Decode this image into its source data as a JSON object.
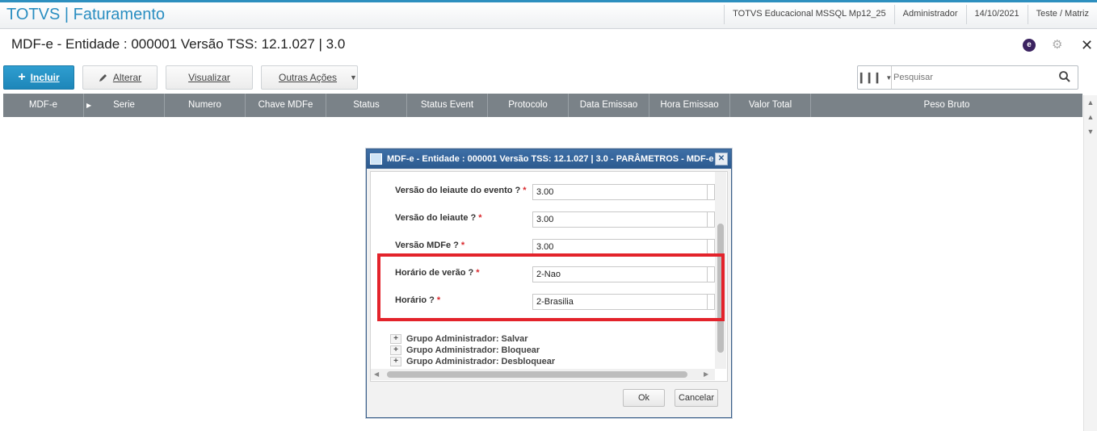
{
  "app": {
    "title": "TOTVS | Faturamento"
  },
  "top_info": [
    "TOTVS Educacional MSSQL Mp12_25",
    "Administrador",
    "14/10/2021",
    "Teste / Matriz"
  ],
  "page": {
    "title": "MDF-e - Entidade : 000001 Versão TSS: 12.1.027 | 3.0",
    "e_badge": "e",
    "gear_glyph": "⚙",
    "close_glyph": "✕"
  },
  "toolbar": {
    "incluir": "Incluir",
    "alterar": "Alterar",
    "visualizar": "Visualizar",
    "outras_acoes": "Outras Ações",
    "search_placeholder": "Pesquisar"
  },
  "grid": {
    "columns": [
      "MDF-e",
      "Serie",
      "Numero",
      "Chave MDFe",
      "Status",
      "Status Event",
      "Protocolo",
      "Data Emissao",
      "Hora Emissao",
      "Valor Total",
      "Peso Bruto"
    ]
  },
  "dialog": {
    "title": "MDF-e - Entidade : 000001 Versão TSS: 12.1.027 | 3.0 - PARÂMETROS - MDF-e",
    "params": [
      {
        "label": "Versão do leiaute do evento ?",
        "value": "3.00"
      },
      {
        "label": "Versão do leiaute ?",
        "value": "3.00"
      },
      {
        "label": "Versão MDFe ?",
        "value": "3.00"
      },
      {
        "label": "Horário de verão ?",
        "value": "2-Nao"
      },
      {
        "label": "Horário ?",
        "value": "2-Brasilia"
      }
    ],
    "groups": [
      "Grupo Administrador: Salvar",
      "Grupo Administrador: Bloquear",
      "Grupo Administrador: Desbloquear"
    ],
    "ok": "Ok",
    "cancel": "Cancelar"
  },
  "colors": {
    "accent": "#2a8ec1",
    "grid_header": "#7a8288",
    "highlight": "#e3232b",
    "dialog_title": "#2c5a8f"
  }
}
